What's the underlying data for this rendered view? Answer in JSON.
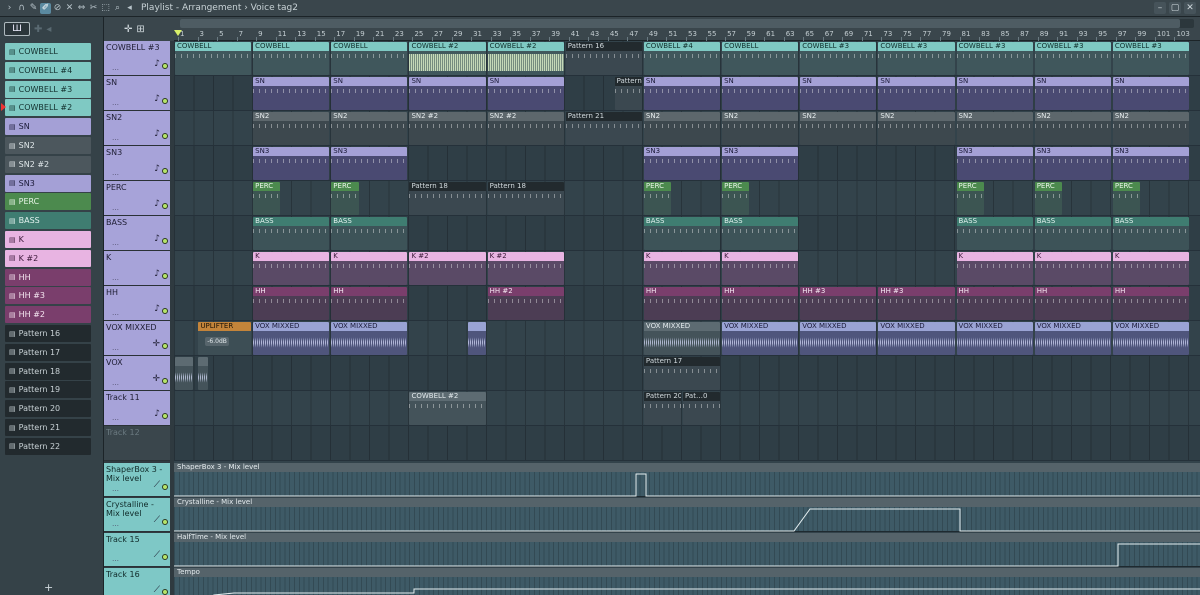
{
  "window": {
    "title": "Playlist - Arrangement › Voice tag2"
  },
  "timeline": {
    "ticks": [
      "1",
      "3",
      "5",
      "7",
      "9",
      "11",
      "13",
      "15",
      "17",
      "19",
      "21",
      "23",
      "25",
      "27",
      "29",
      "31",
      "33",
      "35",
      "37",
      "39",
      "41",
      "43",
      "45",
      "47",
      "49",
      "51",
      "53",
      "55",
      "57",
      "59",
      "61",
      "63",
      "65",
      "67",
      "69",
      "71",
      "73",
      "75",
      "77",
      "79",
      "81",
      "83",
      "85",
      "87",
      "89",
      "91",
      "93",
      "95",
      "97",
      "99",
      "101",
      "103"
    ]
  },
  "picker": {
    "items": [
      {
        "label": "COWBELL",
        "style": "teal"
      },
      {
        "label": "COWBELL #4",
        "style": "teal"
      },
      {
        "label": "COWBELL #3",
        "style": "teal"
      },
      {
        "label": "COWBELL #2",
        "style": "teal"
      },
      {
        "label": "SN",
        "style": "lav"
      },
      {
        "label": "SN2",
        "style": "grey"
      },
      {
        "label": "SN2 #2",
        "style": "grey"
      },
      {
        "label": "SN3",
        "style": "lav"
      },
      {
        "label": "PERC",
        "style": "green"
      },
      {
        "label": "BASS",
        "style": "dteal"
      },
      {
        "label": "K",
        "style": "pink"
      },
      {
        "label": "K #2",
        "style": "pink"
      },
      {
        "label": "HH",
        "style": "plum"
      },
      {
        "label": "HH #3",
        "style": "plum"
      },
      {
        "label": "HH #2",
        "style": "plum"
      },
      {
        "label": "Pattern 16",
        "style": "dark"
      },
      {
        "label": "Pattern 17",
        "style": "dark"
      },
      {
        "label": "Pattern 18",
        "style": "dark"
      },
      {
        "label": "Pattern 19",
        "style": "dark"
      },
      {
        "label": "Pattern 20",
        "style": "dark"
      },
      {
        "label": "Pattern 21",
        "style": "dark"
      },
      {
        "label": "Pattern 22",
        "style": "dark"
      }
    ]
  },
  "tracks": [
    {
      "name": "COWBELL #3"
    },
    {
      "name": "SN"
    },
    {
      "name": "SN2"
    },
    {
      "name": "SN3"
    },
    {
      "name": "PERC"
    },
    {
      "name": "BASS"
    },
    {
      "name": "K"
    },
    {
      "name": "HH"
    },
    {
      "name": "VOX MIXXED"
    },
    {
      "name": "VOX"
    },
    {
      "name": "Track 11"
    },
    {
      "name": "Track 12"
    },
    {
      "name": "ShaperBox 3 - Mix level"
    },
    {
      "name": "Crystalline - Mix level"
    },
    {
      "name": "Track 15"
    },
    {
      "name": "Track 16"
    }
  ],
  "automation": [
    {
      "label": "ShaperBox 3 - Mix level"
    },
    {
      "label": "Crystalline - Mix level"
    },
    {
      "label": "HalfTime - Mix level"
    },
    {
      "label": "Tempo"
    }
  ],
  "clips": [
    {
      "lane": 0,
      "start": 0,
      "end": 4,
      "label": "COWBELL",
      "style": "teal",
      "fill": "notes"
    },
    {
      "lane": 0,
      "start": 4,
      "end": 8,
      "label": "COWBELL",
      "style": "teal",
      "fill": "notes"
    },
    {
      "lane": 0,
      "start": 8,
      "end": 12,
      "label": "COWBELL",
      "style": "teal",
      "fill": "notes"
    },
    {
      "lane": 0,
      "start": 12,
      "end": 16,
      "label": "COWBELL #2",
      "style": "teal",
      "fill": "loud"
    },
    {
      "lane": 0,
      "start": 16,
      "end": 20,
      "label": "COWBELL #2",
      "style": "teal",
      "fill": "loud"
    },
    {
      "lane": 0,
      "start": 20,
      "end": 24,
      "label": "Pattern 16",
      "style": "dark",
      "fill": "notes"
    },
    {
      "lane": 0,
      "start": 24,
      "end": 28,
      "label": "COWBELL #4",
      "style": "teal",
      "fill": "notes"
    },
    {
      "lane": 0,
      "start": 28,
      "end": 32,
      "label": "COWBELL",
      "style": "teal",
      "fill": "notes"
    },
    {
      "lane": 0,
      "start": 32,
      "end": 36,
      "label": "COWBELL #3",
      "style": "teal",
      "fill": "notes"
    },
    {
      "lane": 0,
      "start": 36,
      "end": 40,
      "label": "COWBELL #3",
      "style": "teal",
      "fill": "notes"
    },
    {
      "lane": 0,
      "start": 40,
      "end": 44,
      "label": "COWBELL #3",
      "style": "teal",
      "fill": "notes"
    },
    {
      "lane": 0,
      "start": 44,
      "end": 48,
      "label": "COWBELL #3",
      "style": "teal",
      "fill": "notes"
    },
    {
      "lane": 0,
      "start": 48,
      "end": 52,
      "label": "COWBELL #3",
      "style": "teal",
      "fill": "notes"
    },
    {
      "lane": 1,
      "start": 4,
      "end": 8,
      "label": "SN",
      "style": "lav",
      "fill": "notes"
    },
    {
      "lane": 1,
      "start": 8,
      "end": 12,
      "label": "SN",
      "style": "lav",
      "fill": "notes"
    },
    {
      "lane": 1,
      "start": 12,
      "end": 16,
      "label": "SN",
      "style": "lav",
      "fill": "notes"
    },
    {
      "lane": 1,
      "start": 16,
      "end": 20,
      "label": "SN",
      "style": "lav",
      "fill": "notes"
    },
    {
      "lane": 1,
      "start": 22.5,
      "end": 24,
      "label": "Pattern 19",
      "style": "dark",
      "fill": "notes"
    },
    {
      "lane": 1,
      "start": 24,
      "end": 28,
      "label": "SN",
      "style": "lav",
      "fill": "notes"
    },
    {
      "lane": 1,
      "start": 28,
      "end": 32,
      "label": "SN",
      "style": "lav",
      "fill": "notes"
    },
    {
      "lane": 1,
      "start": 32,
      "end": 36,
      "label": "SN",
      "style": "lav",
      "fill": "notes"
    },
    {
      "lane": 1,
      "start": 36,
      "end": 40,
      "label": "SN",
      "style": "lav",
      "fill": "notes"
    },
    {
      "lane": 1,
      "start": 40,
      "end": 44,
      "label": "SN",
      "style": "lav",
      "fill": "notes"
    },
    {
      "lane": 1,
      "start": 44,
      "end": 48,
      "label": "SN",
      "style": "lav",
      "fill": "notes"
    },
    {
      "lane": 1,
      "start": 48,
      "end": 52,
      "label": "SN",
      "style": "lav",
      "fill": "notes"
    },
    {
      "lane": 2,
      "start": 4,
      "end": 8,
      "label": "SN2",
      "style": "grey",
      "fill": "notes"
    },
    {
      "lane": 2,
      "start": 8,
      "end": 12,
      "label": "SN2",
      "style": "grey",
      "fill": "notes"
    },
    {
      "lane": 2,
      "start": 12,
      "end": 16,
      "label": "SN2 #2",
      "style": "grey",
      "fill": "notes"
    },
    {
      "lane": 2,
      "start": 16,
      "end": 20,
      "label": "SN2 #2",
      "style": "grey",
      "fill": "notes"
    },
    {
      "lane": 2,
      "start": 20,
      "end": 24,
      "label": "Pattern 21",
      "style": "dark",
      "fill": "notes"
    },
    {
      "lane": 2,
      "start": 24,
      "end": 28,
      "label": "SN2",
      "style": "grey",
      "fill": "notes"
    },
    {
      "lane": 2,
      "start": 28,
      "end": 32,
      "label": "SN2",
      "style": "grey",
      "fill": "notes"
    },
    {
      "lane": 2,
      "start": 32,
      "end": 36,
      "label": "SN2",
      "style": "grey",
      "fill": "notes"
    },
    {
      "lane": 2,
      "start": 36,
      "end": 40,
      "label": "SN2",
      "style": "grey",
      "fill": "notes"
    },
    {
      "lane": 2,
      "start": 40,
      "end": 44,
      "label": "SN2",
      "style": "grey",
      "fill": "notes"
    },
    {
      "lane": 2,
      "start": 44,
      "end": 48,
      "label": "SN2",
      "style": "grey",
      "fill": "notes"
    },
    {
      "lane": 2,
      "start": 48,
      "end": 52,
      "label": "SN2",
      "style": "grey",
      "fill": "notes"
    },
    {
      "lane": 3,
      "start": 4,
      "end": 8,
      "label": "SN3",
      "style": "lav",
      "fill": "notes"
    },
    {
      "lane": 3,
      "start": 8,
      "end": 12,
      "label": "SN3",
      "style": "lav",
      "fill": "notes"
    },
    {
      "lane": 3,
      "start": 24,
      "end": 28,
      "label": "SN3",
      "style": "lav",
      "fill": "notes"
    },
    {
      "lane": 3,
      "start": 28,
      "end": 32,
      "label": "SN3",
      "style": "lav",
      "fill": "notes"
    },
    {
      "lane": 3,
      "start": 40,
      "end": 44,
      "label": "SN3",
      "style": "lav",
      "fill": "notes"
    },
    {
      "lane": 3,
      "start": 44,
      "end": 48,
      "label": "SN3",
      "style": "lav",
      "fill": "notes"
    },
    {
      "lane": 3,
      "start": 48,
      "end": 52,
      "label": "SN3",
      "style": "lav",
      "fill": "notes"
    },
    {
      "lane": 4,
      "start": 4,
      "end": 5.5,
      "label": "PERC",
      "style": "green",
      "fill": "notes"
    },
    {
      "lane": 4,
      "start": 8,
      "end": 9.5,
      "label": "PERC",
      "style": "green",
      "fill": "notes"
    },
    {
      "lane": 4,
      "start": 12,
      "end": 16,
      "label": "Pattern 18",
      "style": "dark",
      "fill": "notes"
    },
    {
      "lane": 4,
      "start": 16,
      "end": 20,
      "label": "Pattern 18",
      "style": "dark",
      "fill": "notes"
    },
    {
      "lane": 4,
      "start": 24,
      "end": 25.5,
      "label": "PERC",
      "style": "green",
      "fill": "notes"
    },
    {
      "lane": 4,
      "start": 28,
      "end": 29.5,
      "label": "PERC",
      "style": "green",
      "fill": "notes"
    },
    {
      "lane": 4,
      "start": 40,
      "end": 41.5,
      "label": "PERC",
      "style": "green",
      "fill": "notes"
    },
    {
      "lane": 4,
      "start": 44,
      "end": 45.5,
      "label": "PERC",
      "style": "green",
      "fill": "notes"
    },
    {
      "lane": 4,
      "start": 48,
      "end": 49.5,
      "label": "PERC",
      "style": "green",
      "fill": "notes"
    },
    {
      "lane": 5,
      "start": 4,
      "end": 8,
      "label": "BASS",
      "style": "dteal",
      "fill": "notes"
    },
    {
      "lane": 5,
      "start": 8,
      "end": 12,
      "label": "BASS",
      "style": "dteal",
      "fill": "notes"
    },
    {
      "lane": 5,
      "start": 24,
      "end": 28,
      "label": "BASS",
      "style": "dteal",
      "fill": "notes"
    },
    {
      "lane": 5,
      "start": 28,
      "end": 32,
      "label": "BASS",
      "style": "dteal",
      "fill": "notes"
    },
    {
      "lane": 5,
      "start": 40,
      "end": 44,
      "label": "BASS",
      "style": "dteal",
      "fill": "notes"
    },
    {
      "lane": 5,
      "start": 44,
      "end": 48,
      "label": "BASS",
      "style": "dteal",
      "fill": "notes"
    },
    {
      "lane": 5,
      "start": 48,
      "end": 52,
      "label": "BASS",
      "style": "dteal",
      "fill": "notes"
    },
    {
      "lane": 6,
      "start": 4,
      "end": 8,
      "label": "K",
      "style": "pink",
      "fill": "notes"
    },
    {
      "lane": 6,
      "start": 8,
      "end": 12,
      "label": "K",
      "style": "pink",
      "fill": "notes"
    },
    {
      "lane": 6,
      "start": 12,
      "end": 16,
      "label": "K #2",
      "style": "pink",
      "fill": "notes"
    },
    {
      "lane": 6,
      "start": 16,
      "end": 20,
      "label": "K #2",
      "style": "pink",
      "fill": "notes"
    },
    {
      "lane": 6,
      "start": 24,
      "end": 28,
      "label": "K",
      "style": "pink",
      "fill": "notes"
    },
    {
      "lane": 6,
      "start": 28,
      "end": 32,
      "label": "K",
      "style": "pink",
      "fill": "notes"
    },
    {
      "lane": 6,
      "start": 40,
      "end": 44,
      "label": "K",
      "style": "pink",
      "fill": "notes"
    },
    {
      "lane": 6,
      "start": 44,
      "end": 48,
      "label": "K",
      "style": "pink",
      "fill": "notes"
    },
    {
      "lane": 6,
      "start": 48,
      "end": 52,
      "label": "K",
      "style": "pink",
      "fill": "notes"
    },
    {
      "lane": 7,
      "start": 4,
      "end": 8,
      "label": "HH",
      "style": "plum",
      "fill": "notes"
    },
    {
      "lane": 7,
      "start": 8,
      "end": 12,
      "label": "HH",
      "style": "plum",
      "fill": "notes"
    },
    {
      "lane": 7,
      "start": 16,
      "end": 20,
      "label": "HH #2",
      "style": "plum",
      "fill": "notes"
    },
    {
      "lane": 7,
      "start": 24,
      "end": 28,
      "label": "HH",
      "style": "plum",
      "fill": "notes"
    },
    {
      "lane": 7,
      "start": 28,
      "end": 32,
      "label": "HH",
      "style": "plum",
      "fill": "notes"
    },
    {
      "lane": 7,
      "start": 32,
      "end": 36,
      "label": "HH #3",
      "style": "plum",
      "fill": "notes"
    },
    {
      "lane": 7,
      "start": 36,
      "end": 40,
      "label": "HH #3",
      "style": "plum",
      "fill": "notes"
    },
    {
      "lane": 7,
      "start": 40,
      "end": 44,
      "label": "HH",
      "style": "plum",
      "fill": "notes"
    },
    {
      "lane": 7,
      "start": 44,
      "end": 48,
      "label": "HH",
      "style": "plum",
      "fill": "notes"
    },
    {
      "lane": 7,
      "start": 48,
      "end": 52,
      "label": "HH",
      "style": "plum",
      "fill": "notes"
    },
    {
      "lane": 8,
      "start": 1.2,
      "end": 4,
      "label": "UPLIFTER",
      "style": "orange",
      "fill": "none"
    },
    {
      "lane": 8,
      "start": 4,
      "end": 8,
      "label": "VOX MIXXED",
      "style": "audio",
      "fill": "wave"
    },
    {
      "lane": 8,
      "start": 8,
      "end": 12,
      "label": "VOX MIXXED",
      "style": "audio",
      "fill": "wave"
    },
    {
      "lane": 8,
      "start": 15,
      "end": 16,
      "label": "",
      "style": "audio",
      "fill": "wave"
    },
    {
      "lane": 8,
      "start": 24,
      "end": 28,
      "label": "VOX MIXXED",
      "style": "steel",
      "fill": "wave"
    },
    {
      "lane": 8,
      "start": 28,
      "end": 32,
      "label": "VOX MIXXED",
      "style": "audio",
      "fill": "wave"
    },
    {
      "lane": 8,
      "start": 32,
      "end": 36,
      "label": "VOX MIXXED",
      "style": "audio",
      "fill": "wave"
    },
    {
      "lane": 8,
      "start": 36,
      "end": 40,
      "label": "VOX MIXXED",
      "style": "audio",
      "fill": "wave"
    },
    {
      "lane": 8,
      "start": 40,
      "end": 44,
      "label": "VOX MIXXED",
      "style": "audio",
      "fill": "wave"
    },
    {
      "lane": 8,
      "start": 44,
      "end": 48,
      "label": "VOX MIXXED",
      "style": "audio",
      "fill": "wave"
    },
    {
      "lane": 8,
      "start": 48,
      "end": 52,
      "label": "VOX MIXXED",
      "style": "audio",
      "fill": "wave"
    },
    {
      "lane": 9,
      "start": 0,
      "end": 1,
      "label": "",
      "style": "steel",
      "fill": "wave"
    },
    {
      "lane": 9,
      "start": 1.2,
      "end": 1.8,
      "label": "",
      "style": "steel",
      "fill": "wave"
    },
    {
      "lane": 9,
      "start": 24,
      "end": 28,
      "label": "Pattern 17",
      "style": "dark",
      "fill": "notes"
    },
    {
      "lane": 10,
      "start": 12,
      "end": 16,
      "label": "COWBELL #2",
      "style": "steel",
      "fill": "notes"
    },
    {
      "lane": 10,
      "start": 24,
      "end": 26,
      "label": "Pattern 20",
      "style": "dark",
      "fill": "notes"
    },
    {
      "lane": 10,
      "start": 26,
      "end": 28,
      "label": "Pat…0",
      "style": "dark",
      "fill": "notes"
    }
  ],
  "volume_badge": "-6.0dB"
}
